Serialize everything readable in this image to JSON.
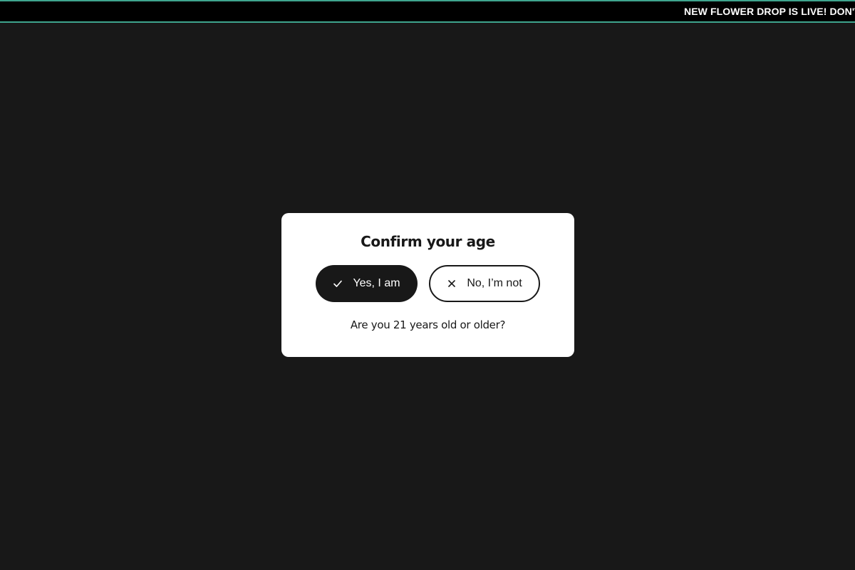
{
  "announcement": {
    "text": "NEW FLOWER DROP IS LIVE! DON'T MISS OUT"
  },
  "age_gate": {
    "title": "Confirm your age",
    "yes_label": "Yes, I am",
    "yes_icon": "check-icon",
    "no_label": "No, I’m not",
    "no_icon": "close-icon",
    "question": "Are you 21 years old or older?"
  },
  "colors": {
    "page_background": "#181818",
    "announcement_background": "#000000",
    "announcement_border": "#3fa58e",
    "modal_background": "#ffffff",
    "primary_button": "#181818"
  }
}
